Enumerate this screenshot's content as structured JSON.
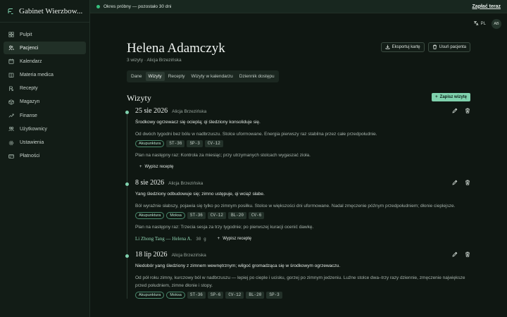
{
  "app": {
    "name": "Gabinet Wierzbow..."
  },
  "sidebar": {
    "items": [
      {
        "label": "Pulpit",
        "icon": "dashboard-icon"
      },
      {
        "label": "Pacjenci",
        "icon": "users-icon",
        "active": true
      },
      {
        "label": "Kalendarz",
        "icon": "calendar-icon"
      },
      {
        "label": "Materia medica",
        "icon": "book-icon"
      },
      {
        "label": "Recepty",
        "icon": "prescription-icon"
      },
      {
        "label": "Magazyn",
        "icon": "box-icon"
      },
      {
        "label": "Finanse",
        "icon": "finance-icon"
      },
      {
        "label": "Użytkownicy",
        "icon": "user-group-icon"
      },
      {
        "label": "Ustawienia",
        "icon": "gear-icon"
      },
      {
        "label": "Płatności",
        "icon": "card-icon"
      }
    ]
  },
  "trial": {
    "text": "Okres próbny — pozostało 30 dni",
    "cta": "Zapłać teraz"
  },
  "topbar": {
    "lang": "PL",
    "avatar": "AB"
  },
  "patient": {
    "name": "Helena Adamczyk",
    "sub": "3 wizyty · Alicja Brzezińska"
  },
  "actions": {
    "export": "Eksportuj kartę",
    "delete": "Usuń pacjenta"
  },
  "tabs": [
    "Dane",
    "Wizyty",
    "Recepty",
    "Wizyty w kalendarzu",
    "Dziennik dostępu"
  ],
  "active_tab": "Wizyty",
  "visits_section": {
    "title": "Wizyty",
    "add": "Zapisz wizytę"
  },
  "visits": [
    {
      "date": "25 sie 2026",
      "doctor": "Alicja Brzezińska",
      "summary": "Środkowy ogrzewacz się ocieplą; qi śledziony konsoliduje się.",
      "desc": "Od dwóch tygodni bez bólu w nadbrzuszu. Stolce uformowane. Energia pierwszy raz stabilna przez całe przedpołudnie.",
      "pills": [
        "Akupunktura"
      ],
      "codes": [
        "ST-36",
        "SP-3",
        "CV-12"
      ],
      "plan": "Plan na następny raz: Kontrola za miesiąc; przy utrzymanych stolcach wygaszać zioła.",
      "rx": "",
      "rx_dose": "",
      "add_rx": "Wypisz receptę"
    },
    {
      "date": "8 sie 2026",
      "doctor": "Alicja Brzezińska",
      "summary": "Yang śledziony odbudowuje się; zimno ustępuje, qi wciąż słabe.",
      "desc": "Ból wyraźnie słabszy, pojawia się tylko po zimnym posiłku. Stolce w większości dni uformowane. Nadal zmęczenie późnym przedpołudniem; dłonie cieplejsze.",
      "pills": [
        "Akupunktura",
        "Moksa"
      ],
      "codes": [
        "ST-36",
        "CV-12",
        "BL-20",
        "CV-6"
      ],
      "plan": "Plan na następny raz: Trzecia sesja za trzy tygodnie; po pierwszej kuracji ocenić dawkę.",
      "rx": "Li Zhong Tang — Helena A.",
      "rx_dose": "30 g",
      "add_rx": "Wypisz receptę"
    },
    {
      "date": "18 lip 2026",
      "doctor": "Alicja Brzezińska",
      "summary": "Niedobór yang śledziony z zimnem wewnętrznym; wilgoć gromadząca się w środkowym ogrzewaczu.",
      "desc": "Od pół roku zimny, kurczowy ból w nadbrzuszu — lepiej po cieple i ucisku, gorzej po zimnym jedzeniu. Luźne stolce dwa–trzy razy dziennie, zmęczenie największe przed południem, zimne dłonie i stopy.",
      "pills": [
        "Akupunktura",
        "Moksa"
      ],
      "codes": [
        "ST-36",
        "SP-6",
        "CV-12",
        "BL-20",
        "SP-3"
      ],
      "plan": "",
      "rx": "",
      "rx_dose": "",
      "add_rx": ""
    }
  ]
}
